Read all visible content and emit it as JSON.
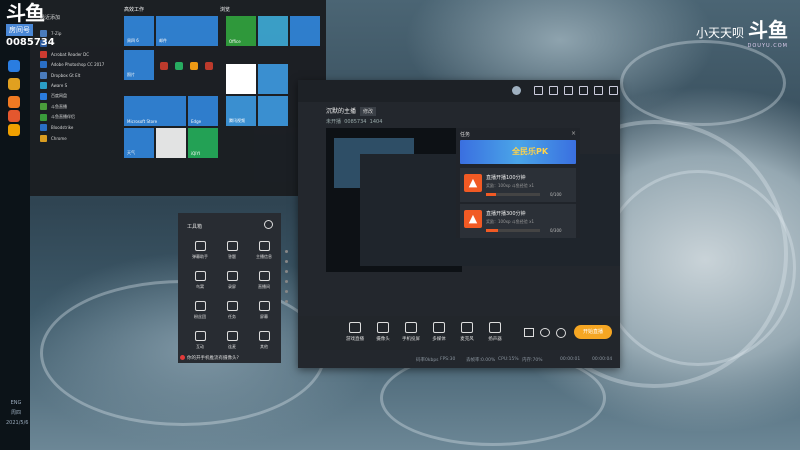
{
  "watermark": {
    "left_tag": "房间号",
    "room_id": "0085734",
    "right_text": "小天天呗",
    "brand": "斗鱼",
    "url": "DOUYU.COM"
  },
  "taskbar": {
    "icons": [
      {
        "name": "edge-icon",
        "color": "#2a7de1"
      },
      {
        "name": "chrome-icon",
        "color": "#e0a020"
      },
      {
        "name": "firefox-icon",
        "color": "#f07a22"
      },
      {
        "name": "firefox-icon",
        "color": "#e4572e"
      },
      {
        "name": "app-icon",
        "color": "#f0a000"
      }
    ],
    "clock_lines": [
      "ENG",
      "周四",
      "2021/5/6"
    ]
  },
  "start_menu": {
    "section_label": "最近添加",
    "apps": [
      {
        "label": "7-Zip",
        "color": "#4b7dbf"
      },
      {
        "label": "",
        "color": "#2c5aa0"
      },
      {
        "label": "Acrobat Reader DC",
        "color": "#d23a2f"
      },
      {
        "label": "Adobe Photoshop CC 2017",
        "color": "#2a70c9"
      },
      {
        "label": "Dropbox Gt Elt",
        "color": "#4b7dbf"
      },
      {
        "label": "Aware S",
        "color": "#2aa0c9"
      },
      {
        "label": "百度网盘",
        "color": "#2a7de1"
      },
      {
        "label": "斗鱼直播",
        "color": "#4b9f3a"
      },
      {
        "label": "斗鱼直播伴侣",
        "color": "#3a9f3a"
      },
      {
        "label": "Bloodstrike",
        "color": "#2a70c9"
      },
      {
        "label": "Chrome",
        "color": "#e0a020"
      }
    ],
    "groups": [
      "高效工作",
      "浏览"
    ],
    "tiles": [
      {
        "label": "周四 6",
        "color": "#2f7fd0"
      },
      {
        "label": "邮件",
        "color": "#2f7fd0"
      },
      {
        "label": "Office",
        "color": "#2f9a3a"
      },
      {
        "label": "",
        "color": "#3aa0c9"
      },
      {
        "label": "照片",
        "color": "#2f7fd0"
      },
      {
        "label": "天气",
        "color": "#2f7fd0"
      },
      {
        "label": "Edge",
        "color": "#2f7fd0"
      },
      {
        "label": "Microsoft Store",
        "color": "#2f7fd0"
      },
      {
        "label": "",
        "color": "#ffffff"
      },
      {
        "label": "腾讯视频",
        "color": "#2f7fd0"
      },
      {
        "label": "",
        "color": "#e8e8e8"
      },
      {
        "label": "iQIYI",
        "color": "#23a455"
      },
      {
        "label": "",
        "color": "#3a8fd0"
      },
      {
        "label": "",
        "color": "#3a8fd0"
      }
    ]
  },
  "douyu_window": {
    "room_title": "沉默的主播",
    "room_tag": "修改",
    "room_meta": [
      "未开播",
      "0085734",
      "1404"
    ],
    "task_panel": {
      "title": "任务",
      "banner": "全民乐PK",
      "tasks": [
        {
          "name": "直播开播100分钟",
          "desc": "奖励：100xp 斗鱼经验 x1",
          "progress": "0/100",
          "fill_pct": 18
        },
        {
          "name": "直播开播300分钟",
          "desc": "奖励：100xp 斗鱼经验 x1",
          "progress": "0/300",
          "fill_pct": 22
        }
      ]
    },
    "tools": [
      "游戏直播",
      "摄像头",
      "手机投屏",
      "多媒体",
      "麦克风",
      "扬声器"
    ],
    "start_button": "开始直播",
    "stats": [
      "码率0kbps",
      "FPS:30",
      "丢帧率:0.00%",
      "CPU:15%",
      "内存:70%"
    ],
    "times": [
      "00:00:01",
      "00:00:04"
    ]
  },
  "toolbox": {
    "title": "工具箱",
    "items": [
      "弹幕助手",
      "答题",
      "主播信息",
      "鸟窝",
      "录屏",
      "直播间",
      "粉丝团",
      "任务",
      "屏幕",
      "互动",
      "连麦",
      "其他"
    ],
    "notice": "你的开手机推流有摄像头?"
  }
}
